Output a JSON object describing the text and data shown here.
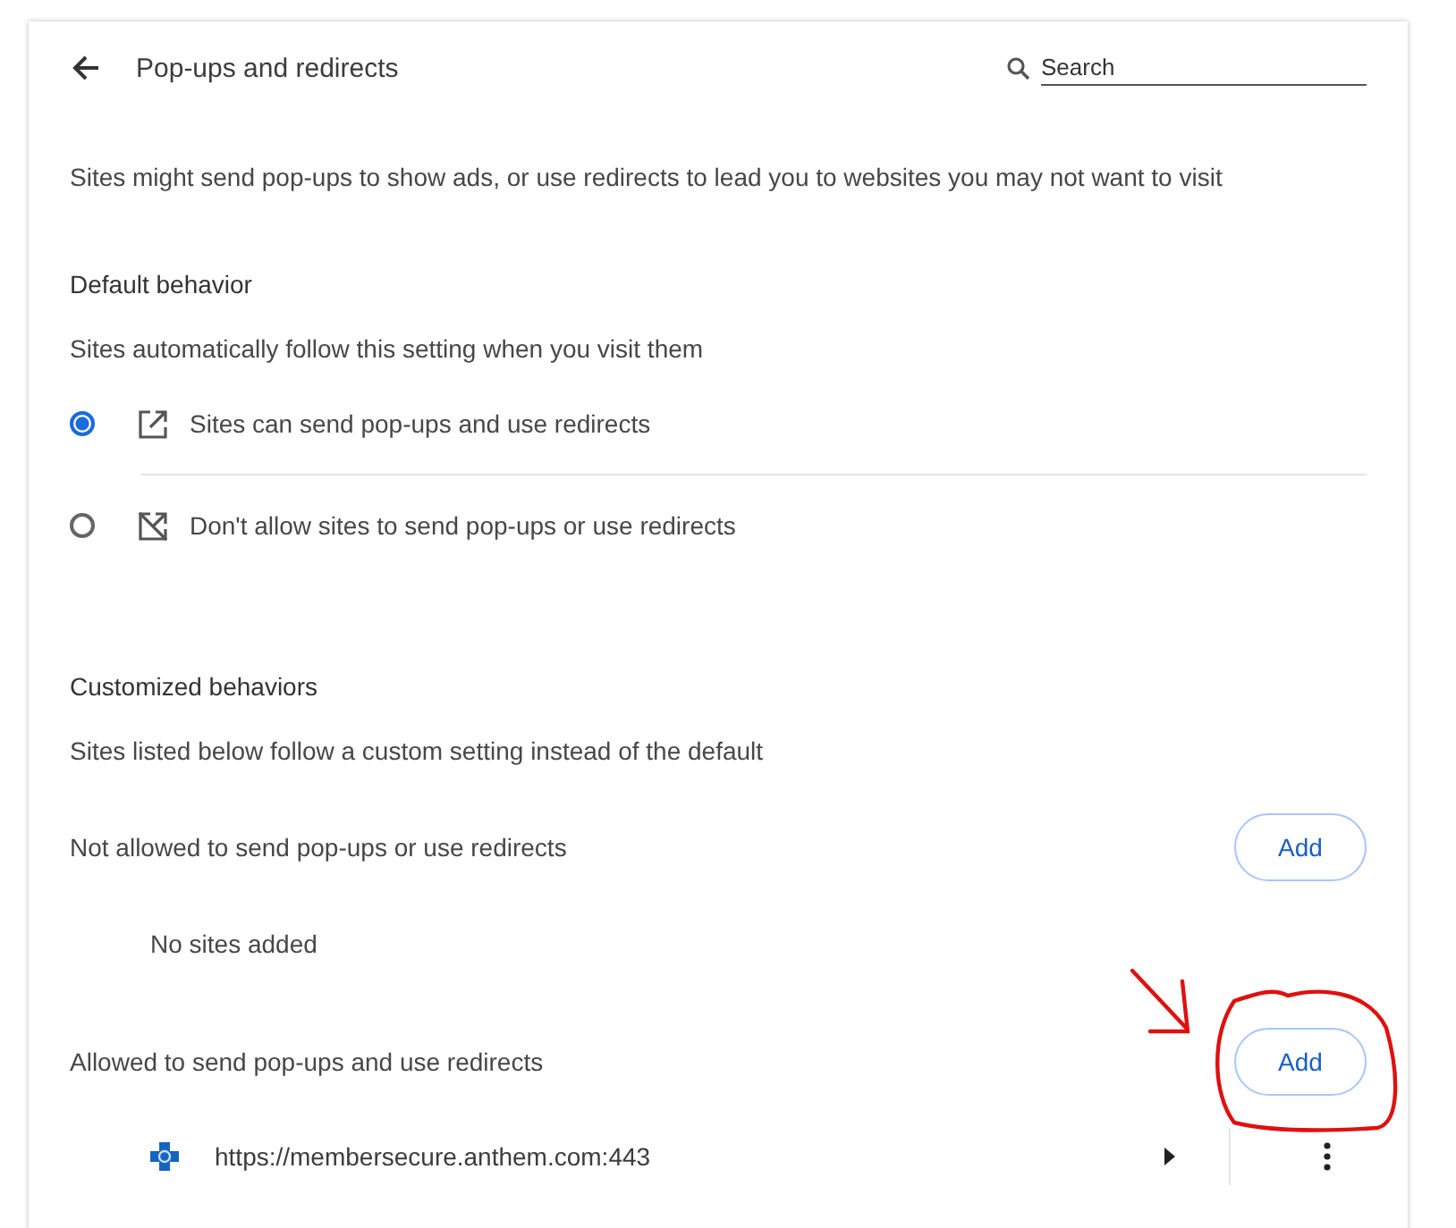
{
  "header": {
    "title": "Pop-ups and redirects",
    "search": {
      "placeholder": "Search"
    }
  },
  "description": "Sites might send pop-ups to show ads, or use redirects to lead you to websites you may not want to visit",
  "default_behavior": {
    "heading": "Default behavior",
    "subtitle": "Sites automatically follow this setting when you visit them",
    "options": [
      {
        "label": "Sites can send pop-ups and use redirects",
        "selected": true,
        "kind": "allow"
      },
      {
        "label": "Don't allow sites to send pop-ups or use redirects",
        "selected": false,
        "kind": "block"
      }
    ]
  },
  "customized": {
    "heading": "Customized behaviors",
    "subtitle": "Sites listed below follow a custom setting instead of the default",
    "sections": [
      {
        "label": "Not allowed to send pop-ups or use redirects",
        "button": "Add",
        "empty_text": "No sites added"
      },
      {
        "label": "Allowed to send pop-ups and use redirects",
        "button": "Add",
        "sites": [
          {
            "url": "https://membersecure.anthem.com:443"
          }
        ]
      }
    ]
  }
}
